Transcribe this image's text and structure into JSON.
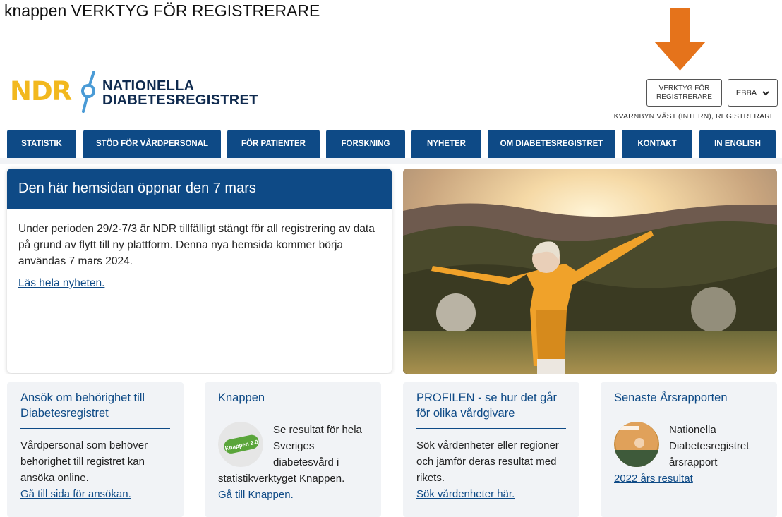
{
  "caption": "knappen VERKTYG FÖR REGISTRERARE",
  "logo": {
    "abbr": "NDR",
    "line1": "NATIONELLA",
    "line2": "DIABETESREGISTRET"
  },
  "header": {
    "tool_button_line1": "VERKTYG FÖR",
    "tool_button_line2": "REGISTRERARE",
    "user_button": "EBBA",
    "user_role": "KVARNBYN VÄST (INTERN), REGISTRERARE"
  },
  "nav": {
    "items": [
      {
        "label": "STATISTIK"
      },
      {
        "label": "STÖD FÖR VÅRDPERSONAL"
      },
      {
        "label": "FÖR PATIENTER"
      },
      {
        "label": "FORSKNING"
      },
      {
        "label": "NYHETER"
      },
      {
        "label": "OM DIABETESREGISTRET"
      },
      {
        "label": "KONTAKT"
      },
      {
        "label": "IN ENGLISH"
      }
    ]
  },
  "news": {
    "title": "Den här hemsidan öppnar den 7 mars",
    "body": "Under perioden 29/2-7/3 är NDR tillfälligt stängt för all registrering av data på grund av flytt till ny plattform. Denna nya hemsida kommer börja användas 7 mars 2024.",
    "link": "Läs hela nyheten."
  },
  "cards": [
    {
      "title": "Ansök om behörighet till Diabetesregistret",
      "text": "Vårdpersonal som behöver behörighet till registret kan ansöka online.",
      "link": "Gå till sida för ansökan."
    },
    {
      "title": "Knappen",
      "text": "Se resultat för hela Sveriges diabetesvård i statistikverktyget Knappen.",
      "badge": "Knappen 2.0",
      "link": "Gå till Knappen."
    },
    {
      "title": "PROFILEN - se hur det går för olika vårdgivare",
      "text": "Sök vårdenheter eller regioner och jämför deras resultat med rikets.",
      "link": "Sök vårdenheter här."
    },
    {
      "title": "Senaste Årsrapporten",
      "text": "Nationella Diabetesregistret årsrapport",
      "link": "2022 års resultat"
    }
  ],
  "colors": {
    "brand_blue": "#0e4a86",
    "logo_yellow": "#f2b81e",
    "arrow_orange": "#e5731b",
    "card_bg": "#f1f3f6"
  },
  "icons": {
    "arrow": "down-arrow-icon",
    "chevron": "chevron-down-icon"
  }
}
